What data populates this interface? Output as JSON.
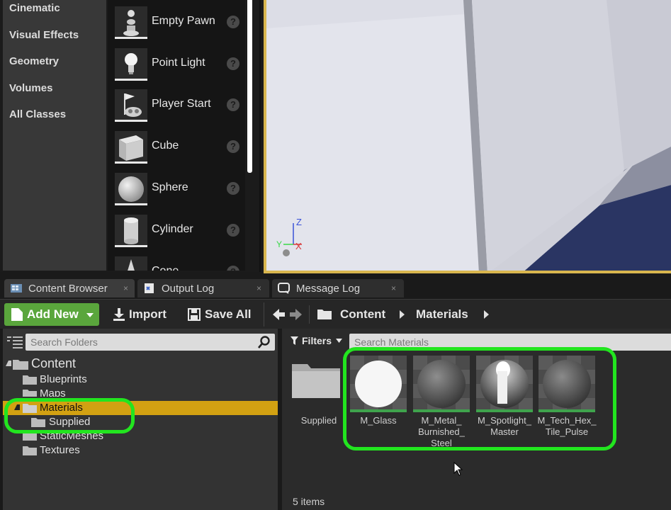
{
  "place_actors": {
    "categories": [
      "Cinematic",
      "Visual Effects",
      "Geometry",
      "Volumes",
      "All Classes"
    ],
    "actors": [
      {
        "label": "Empty Pawn",
        "icon": "pawn-icon"
      },
      {
        "label": "Point Light",
        "icon": "lightbulb-icon"
      },
      {
        "label": "Player Start",
        "icon": "player-start-icon"
      },
      {
        "label": "Cube",
        "icon": "cube-icon"
      },
      {
        "label": "Sphere",
        "icon": "sphere-icon"
      },
      {
        "label": "Cylinder",
        "icon": "cylinder-icon"
      },
      {
        "label": "Cone",
        "icon": "cone-icon"
      }
    ],
    "help_glyph": "?"
  },
  "viewport": {
    "axis": {
      "z": "Z",
      "y": "Y",
      "x": "X"
    }
  },
  "tabs": [
    {
      "label": "Content Browser",
      "icon": "content-browser-icon",
      "active": true
    },
    {
      "label": "Output Log",
      "icon": "output-log-icon",
      "active": false
    },
    {
      "label": "Message Log",
      "icon": "message-log-icon",
      "active": false
    }
  ],
  "toolbar": {
    "add_new": "Add New",
    "import": "Import",
    "save_all": "Save All",
    "breadcrumb": [
      "Content",
      "Materials"
    ]
  },
  "folders": {
    "search_placeholder": "Search Folders",
    "tree": [
      {
        "label": "Content",
        "level": 0,
        "expanded": true,
        "selected": false
      },
      {
        "label": "Blueprints",
        "level": 1,
        "expanded": false,
        "selected": false
      },
      {
        "label": "Maps",
        "level": 1,
        "expanded": false,
        "selected": false
      },
      {
        "label": "Materials",
        "level": 1,
        "expanded": true,
        "selected": true
      },
      {
        "label": "Supplied",
        "level": 2,
        "expanded": false,
        "selected": false
      },
      {
        "label": "StaticMeshes",
        "level": 1,
        "expanded": false,
        "selected": false
      },
      {
        "label": "Textures",
        "level": 1,
        "expanded": false,
        "selected": false
      }
    ]
  },
  "assets": {
    "filters_label": "Filters",
    "search_placeholder": "Search Materials",
    "items": [
      {
        "label": "Supplied",
        "type": "folder"
      },
      {
        "label": "M_Glass",
        "type": "material"
      },
      {
        "label": "M_Metal_ Burnished_ Steel",
        "type": "material"
      },
      {
        "label": "M_Spotlight_ Master",
        "type": "material"
      },
      {
        "label": "M_Tech_Hex_ Tile_Pulse",
        "type": "material"
      }
    ],
    "item_count": "5 items"
  },
  "colors": {
    "add_new_green": "#5aa63c",
    "selected_folder": "#d2a112",
    "viewport_border": "#d9b64e",
    "highlight": "#22e51f"
  }
}
